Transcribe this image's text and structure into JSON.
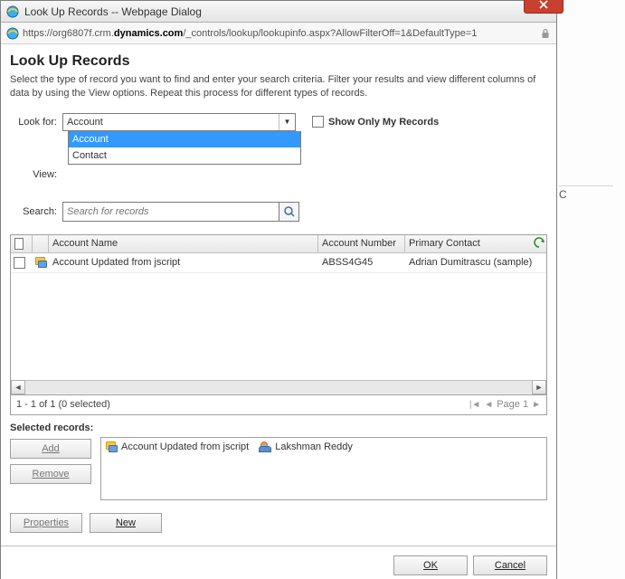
{
  "window": {
    "title": "Look Up Records -- Webpage Dialog",
    "url_prefix": "https://org6807f.crm.",
    "url_bold": "dynamics.com",
    "url_suffix": "/_controls/lookup/lookupinfo.aspx?AllowFilterOff=1&DefaultType=1"
  },
  "page": {
    "title": "Look Up Records",
    "instructions": "Select the type of record you want to find and enter your search criteria. Filter your results and view different columns of data by using the View options. Repeat this process for different types of records."
  },
  "form": {
    "look_for_label": "Look for:",
    "look_for_value": "Account",
    "view_label": "View:",
    "search_label": "Search:",
    "search_placeholder": "Search for records",
    "show_only_label": "Show Only My Records",
    "dropdown_options": [
      "Account",
      "Contact"
    ]
  },
  "grid": {
    "columns": {
      "name": "Account Name",
      "number": "Account Number",
      "contact": "Primary Contact"
    },
    "rows": [
      {
        "name": "Account Updated from jscript",
        "number": "ABSS4G45",
        "contact": "Adrian Dumitrascu (sample)"
      }
    ],
    "pager_text": "1 - 1 of 1 (0 selected)",
    "page_label": "Page 1"
  },
  "selected": {
    "label": "Selected records:",
    "items": [
      {
        "type": "account",
        "text": "Account Updated from jscript"
      },
      {
        "type": "contact",
        "text": "Lakshman Reddy"
      }
    ]
  },
  "buttons": {
    "add": "Add",
    "remove": "Remove",
    "properties": "Properties",
    "new": "New",
    "ok": "OK",
    "cancel": "Cancel"
  },
  "side_char": "C"
}
